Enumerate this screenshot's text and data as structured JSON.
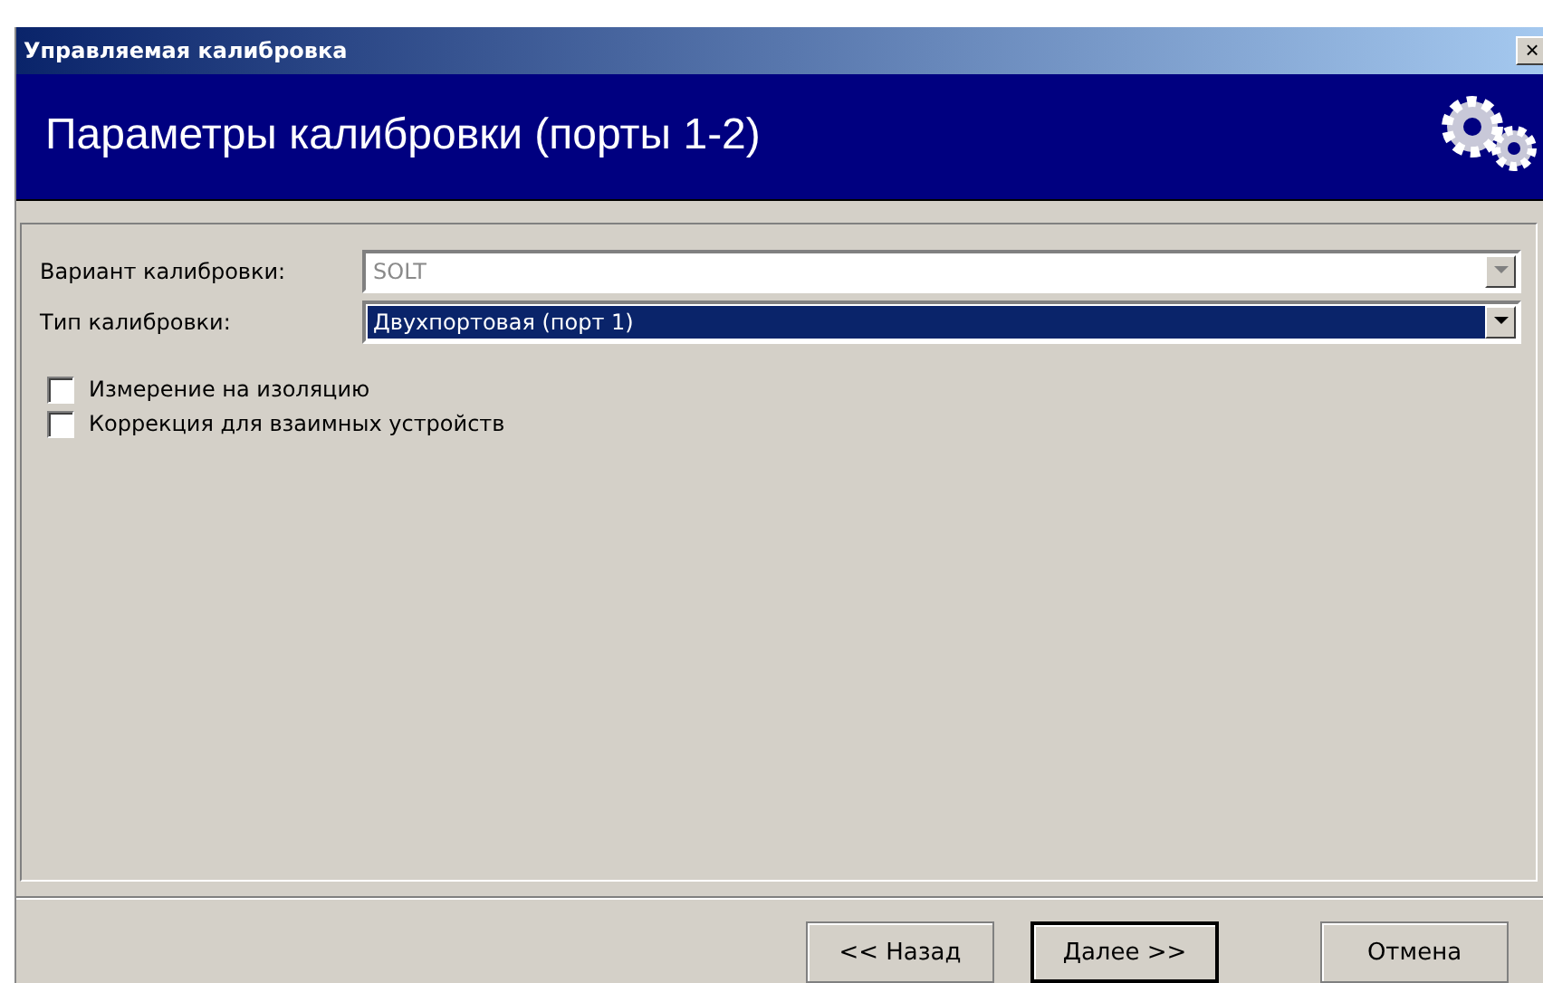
{
  "window": {
    "title": "Управляемая калибровка",
    "close": "×"
  },
  "header": {
    "title": "Параметры калибровки (порты 1-2)"
  },
  "fields": [
    {
      "label": "Вариант калибровки:",
      "value": "SOLT",
      "disabled": true,
      "selected": false
    },
    {
      "label": "Тип калибровки:",
      "value": "Двухпортовая (порт 1)",
      "disabled": false,
      "selected": true
    }
  ],
  "options": [
    {
      "label": "Измерение на изоляцию",
      "checked": false
    },
    {
      "label": "Коррекция для взаимных устройств",
      "checked": false
    }
  ],
  "buttons": [
    {
      "label": "<< Назад",
      "default": false
    },
    {
      "label": "Далее >>",
      "default": true
    },
    {
      "label": "Отмена",
      "default": false
    }
  ]
}
